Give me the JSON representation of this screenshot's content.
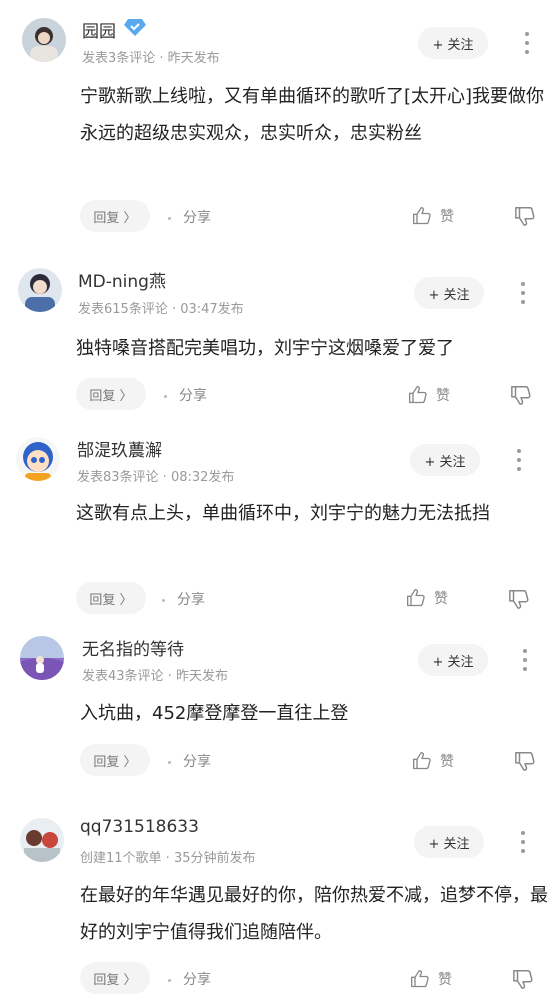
{
  "comments": [
    {
      "username": "园园",
      "verified": true,
      "meta": "发表3条评论 · 昨天发布",
      "follow": "+ 关注",
      "text": "宁歌新歌上线啦，又有单曲循环的歌听了[太开心]我要做你永远的超级忠实观众，忠实听众，忠实粉丝",
      "reply": "回复 〉",
      "share": "分享",
      "like": "赞"
    },
    {
      "username": "MD-ning燕",
      "verified": false,
      "meta": "发表615条评论 · 03:47发布",
      "follow": "+ 关注",
      "text": "独特嗓音搭配完美唱功，刘宇宁这烟嗓爱了爱了",
      "reply": "回复 〉",
      "share": "分享",
      "like": "赞"
    },
    {
      "username": "郜湜玖蕽澥",
      "verified": false,
      "meta": "发表83条评论 · 08:32发布",
      "follow": "+ 关注",
      "text": "这歌有点上头，单曲循环中，刘宇宁的魅力无法抵挡",
      "reply": "回复 〉",
      "share": "分享",
      "like": "赞"
    },
    {
      "username": "无名指的等待",
      "verified": false,
      "meta": "发表43条评论 · 昨天发布",
      "follow": "+ 关注",
      "text": "入坑曲，452摩登摩登一直往上登",
      "reply": "回复 〉",
      "share": "分享",
      "like": "赞"
    },
    {
      "username": "qq731518633",
      "verified": false,
      "meta": "创建11个歌单 · 35分钟前发布",
      "follow": "+ 关注",
      "text": "在最好的年华遇见最好的你，陪你热爱不减，追梦不停，最好的刘宇宁值得我们追随陪伴。",
      "reply": "回复 〉",
      "share": "分享",
      "like": "赞"
    }
  ]
}
